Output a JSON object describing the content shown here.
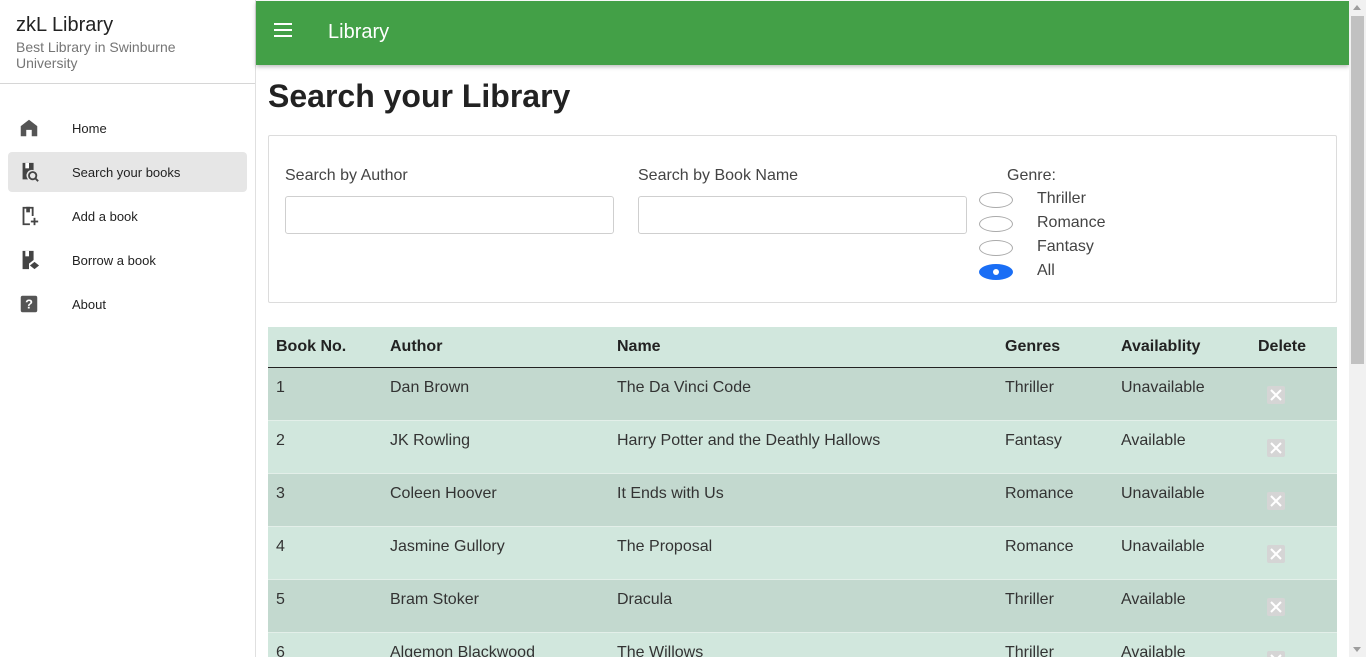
{
  "brand": {
    "title": "zkL Library",
    "subtitle": "Best Library in Swinburne University"
  },
  "topbar": {
    "title": "Library"
  },
  "sidebar": {
    "items": [
      {
        "label": "Home",
        "icon": "home-icon"
      },
      {
        "label": "Search your books",
        "icon": "book-search-icon",
        "active": true
      },
      {
        "label": "Add a book",
        "icon": "book-plus-icon"
      },
      {
        "label": "Borrow a book",
        "icon": "book-borrow-icon"
      },
      {
        "label": "About",
        "icon": "help-icon"
      }
    ]
  },
  "main": {
    "title": "Search your Library",
    "search": {
      "author_label": "Search by Author",
      "author_value": "",
      "name_label": "Search by Book Name",
      "name_value": "",
      "genre_label": "Genre:",
      "genres": [
        "Thriller",
        "Romance",
        "Fantasy",
        "All"
      ],
      "selected_genre": "All"
    },
    "table": {
      "headers": {
        "no": "Book No.",
        "author": "Author",
        "name": "Name",
        "genres": "Genres",
        "availability": "Availablity",
        "delete": "Delete"
      },
      "rows": [
        {
          "no": "1",
          "author": "Dan Brown",
          "name": "The Da Vinci Code",
          "genre": "Thriller",
          "availability": "Unavailable"
        },
        {
          "no": "2",
          "author": "JK Rowling",
          "name": "Harry Potter and the Deathly Hallows",
          "genre": "Fantasy",
          "availability": "Available"
        },
        {
          "no": "3",
          "author": "Coleen Hoover",
          "name": "It Ends with Us",
          "genre": "Romance",
          "availability": "Unavailable"
        },
        {
          "no": "4",
          "author": "Jasmine Gullory",
          "name": "The Proposal",
          "genre": "Romance",
          "availability": "Unavailable"
        },
        {
          "no": "5",
          "author": "Bram Stoker",
          "name": "Dracula",
          "genre": "Thriller",
          "availability": "Available"
        },
        {
          "no": "6",
          "author": "Algemon Blackwood",
          "name": "The Willows",
          "genre": "Thriller",
          "availability": "Available"
        }
      ]
    }
  },
  "colors": {
    "appbar": "#43a047",
    "row_odd": "#c3d9cf",
    "row_even": "#d1e7dd",
    "radio_checked": "#1a6ef5"
  }
}
